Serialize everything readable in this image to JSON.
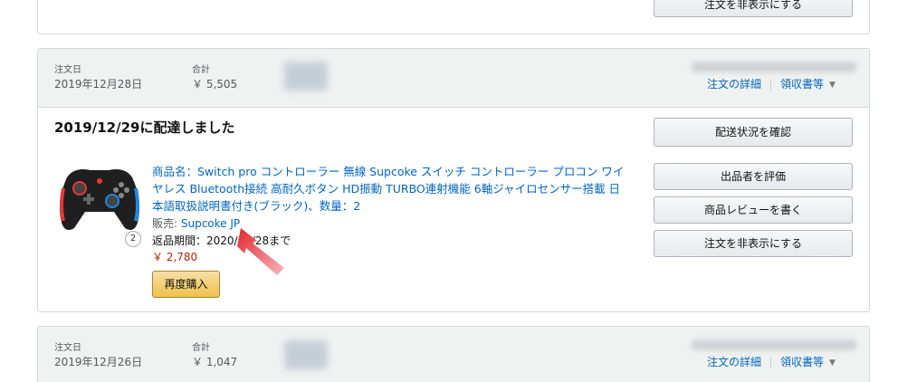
{
  "top_partial": {
    "hide_order_label": "注文を非表示にする"
  },
  "order1": {
    "date_label": "注文日",
    "date_value": "2019年12月28日",
    "total_label": "合計",
    "total_value": "￥ 5,505",
    "details_link": "注文の詳細",
    "receipt_link": "領収書等",
    "delivery_status": "2019/12/29に配達しました",
    "quantity": "2",
    "product_name": "商品名：Switch pro コントローラー 無線 Supcoke スイッチ コントローラー プロコン ワイヤレス Bluetooth接続 高耐久ボタン HD振動 TURBO連射機能 6軸ジャイロセンサー搭載 日本語取扱説明書付き(ブラック)、数量：2",
    "seller_label": "販売: ",
    "seller_name": "Supcoke JP",
    "return_period": "返品期間：2020/01/28まで",
    "price": "￥ 2,780",
    "buy_again_label": "再度購入",
    "buttons": {
      "track": "配送状況を確認",
      "rate_seller": "出品者を評価",
      "write_review": "商品レビューを書く",
      "hide_order": "注文を非表示にする"
    }
  },
  "order2": {
    "date_label": "注文日",
    "date_value": "2019年12月26日",
    "total_label": "合計",
    "total_value": "￥ 1,047",
    "details_link": "注文の詳細",
    "receipt_link": "領収書等"
  },
  "colors": {
    "link": "#0066c0",
    "price": "#b12704",
    "buy_again": "#f0c14b",
    "header_bg": "#f0f2f2",
    "arrow": "#e3262e"
  }
}
